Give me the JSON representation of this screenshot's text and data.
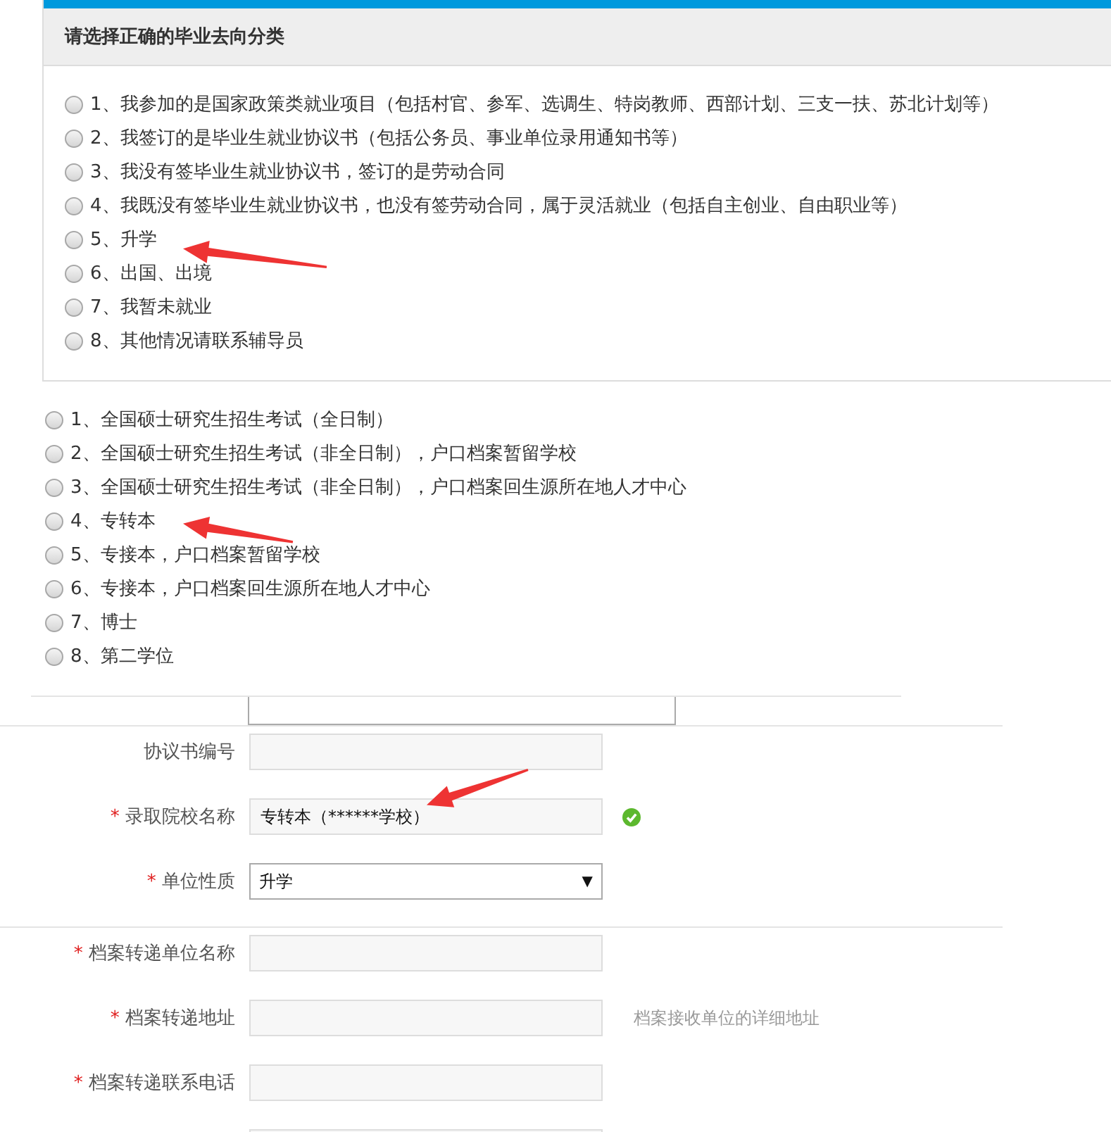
{
  "panel": {
    "title": "请选择正确的毕业去向分类"
  },
  "destination_options": [
    {
      "label": "1、我参加的是国家政策类就业项目（包括村官、参军、选调生、特岗教师、西部计划、三支一扶、苏北计划等）",
      "selected": false
    },
    {
      "label": "2、我签订的是毕业生就业协议书（包括公务员、事业单位录用通知书等）",
      "selected": false
    },
    {
      "label": "3、我没有签毕业生就业协议书，签订的是劳动合同",
      "selected": false
    },
    {
      "label": "4、我既没有签毕业生就业协议书，也没有签劳动合同，属于灵活就业（包括自主创业、自由职业等）",
      "selected": false
    },
    {
      "label": "5、升学",
      "selected": false
    },
    {
      "label": "6、出国、出境",
      "selected": false
    },
    {
      "label": "7、我暂未就业",
      "selected": false
    },
    {
      "label": "8、其他情况请联系辅导员",
      "selected": false
    }
  ],
  "study_options": [
    {
      "label": "1、全国硕士研究生招生考试（全日制）",
      "selected": false
    },
    {
      "label": "2、全国硕士研究生招生考试（非全日制），户口档案暂留学校",
      "selected": false
    },
    {
      "label": "3、全国硕士研究生招生考试（非全日制），户口档案回生源所在地人才中心",
      "selected": false
    },
    {
      "label": "4、专转本",
      "selected": false
    },
    {
      "label": "5、专接本，户口档案暂留学校",
      "selected": false
    },
    {
      "label": "6、专接本，户口档案回生源所在地人才中心",
      "selected": false
    },
    {
      "label": "7、博士",
      "selected": false
    },
    {
      "label": "8、第二学位",
      "selected": false
    }
  ],
  "form_groups": [
    [
      {
        "kind": "input",
        "label": "协议书编号",
        "required": false,
        "valid": false
      },
      {
        "kind": "input",
        "label": "录取院校名称",
        "required": true,
        "value": "专转本（******学校）",
        "valid": true
      },
      {
        "kind": "select",
        "label": "单位性质",
        "required": true,
        "value": "升学",
        "caret": "▼"
      }
    ],
    [
      {
        "kind": "input",
        "label": "档案转递单位名称",
        "required": true,
        "valid": false
      },
      {
        "kind": "input",
        "label": "档案转递地址",
        "required": true,
        "valid": false,
        "hint": "档案接收单位的详细地址"
      },
      {
        "kind": "input",
        "label": "档案转递联系电话",
        "required": true,
        "valid": false
      },
      {
        "kind": "input"
      }
    ]
  ],
  "required_mark": "*",
  "annotations": [
    {
      "kind": "arrow"
    },
    {
      "kind": "arrow"
    },
    {
      "kind": "arrow"
    }
  ]
}
